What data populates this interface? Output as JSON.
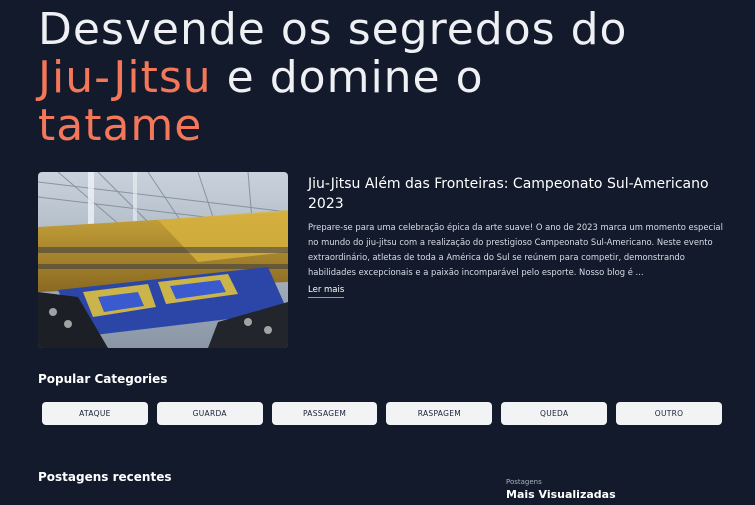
{
  "hero": {
    "line1": "Desvende os segredos do",
    "accent1": "Jiu-Jitsu",
    "middle": " e domine o",
    "accent2": "tatame"
  },
  "featured_post": {
    "title": "Jiu-Jitsu Além das Fronteiras: Campeonato Sul-Americano 2023",
    "excerpt": "Prepare-se para uma celebração épica da arte suave! O ano de 2023 marca um momento especial no mundo do jiu-jitsu com a realização do prestigioso Campeonato Sul-Americano. Neste evento extraordinário, atletas de toda a América do Sul se reúnem para competir, demonstrando habilidades excepcionais e a paixão incomparável pelo esporte. Nosso blog é ...",
    "read_more": "Ler mais"
  },
  "categories": {
    "heading": "Popular Categories",
    "items": [
      "ATAQUE",
      "GUARDA",
      "PASSAGEM",
      "RASPAGEM",
      "QUEDA",
      "OUTRO"
    ]
  },
  "recent": {
    "heading": "Postagens recentes"
  },
  "most_viewed": {
    "label": "Postagens",
    "title": "Mais Visualizadas"
  },
  "colors": {
    "background": "#121a2b",
    "accent": "#f4775a",
    "button_bg": "#f2f3f5"
  }
}
